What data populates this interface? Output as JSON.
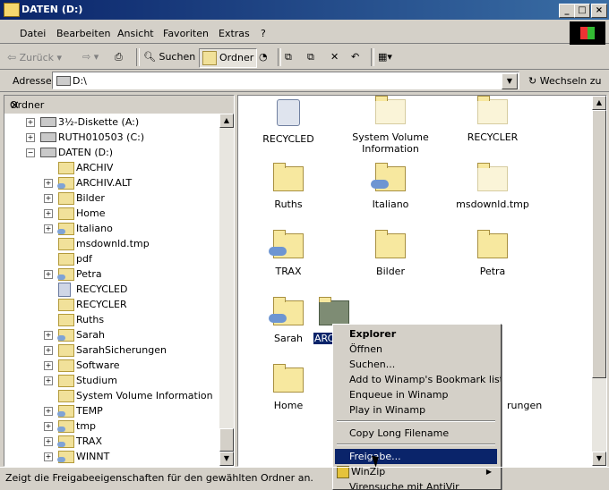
{
  "window": {
    "title": "DATEN (D:)",
    "buttons": [
      "_",
      "□",
      "×"
    ]
  },
  "menu": [
    "Datei",
    "Bearbeiten",
    "Ansicht",
    "Favoriten",
    "Extras",
    "?"
  ],
  "toolbar": {
    "back": "Zurück",
    "search": "Suchen",
    "folders": "Ordner"
  },
  "address": {
    "label": "Adresse",
    "value": "D:\\",
    "go": "Wechseln zu"
  },
  "left_pane": {
    "title": "Ordner",
    "items": [
      {
        "label": "3½-Diskette (A:)",
        "exp": "+"
      },
      {
        "label": "RUTH010503 (C:)",
        "exp": "+"
      },
      {
        "label": "DATEN (D:)",
        "exp": "-"
      },
      {
        "label": "ARCHIV",
        "exp": ""
      },
      {
        "label": "ARCHIV.ALT",
        "exp": "+"
      },
      {
        "label": "Bilder",
        "exp": "+"
      },
      {
        "label": "Home",
        "exp": "+"
      },
      {
        "label": "Italiano",
        "exp": "+"
      },
      {
        "label": "msdownld.tmp",
        "exp": ""
      },
      {
        "label": "pdf",
        "exp": ""
      },
      {
        "label": "Petra",
        "exp": "+"
      },
      {
        "label": "RECYCLED",
        "exp": ""
      },
      {
        "label": "RECYCLER",
        "exp": ""
      },
      {
        "label": "Ruths",
        "exp": ""
      },
      {
        "label": "Sarah",
        "exp": "+"
      },
      {
        "label": "SarahSicherungen",
        "exp": "+"
      },
      {
        "label": "Software",
        "exp": "+"
      },
      {
        "label": "Studium",
        "exp": "+"
      },
      {
        "label": "System Volume Information",
        "exp": ""
      },
      {
        "label": "TEMP",
        "exp": "+"
      },
      {
        "label": "tmp",
        "exp": "+"
      },
      {
        "label": "TRAX",
        "exp": "+"
      },
      {
        "label": "WINNT",
        "exp": "+"
      }
    ]
  },
  "right_pane": {
    "icons": [
      {
        "label": "RECYCLED"
      },
      {
        "label": "System Volume Information"
      },
      {
        "label": "RECYCLER"
      },
      {
        "label": "Ruths"
      },
      {
        "label": "Italiano"
      },
      {
        "label": "msdownld.tmp"
      },
      {
        "label": "TRAX"
      },
      {
        "label": "Bilder"
      },
      {
        "label": "Petra"
      },
      {
        "label": "Sarah"
      },
      {
        "label": "ARC"
      },
      {
        "label": "Home"
      },
      {
        "label": "rungen"
      }
    ]
  },
  "context_menu": {
    "items": [
      "Explorer",
      "Öffnen",
      "Suchen...",
      "Add to Winamp's Bookmark list",
      "Enqueue in Winamp",
      "Play in Winamp",
      "Copy Long Filename",
      "Freigabe...",
      "WinZip",
      "Virensuche mit AntiVir"
    ]
  },
  "status": {
    "text": "Zeigt die Freigabeeigenschaften für den gewählten Ordner an."
  }
}
